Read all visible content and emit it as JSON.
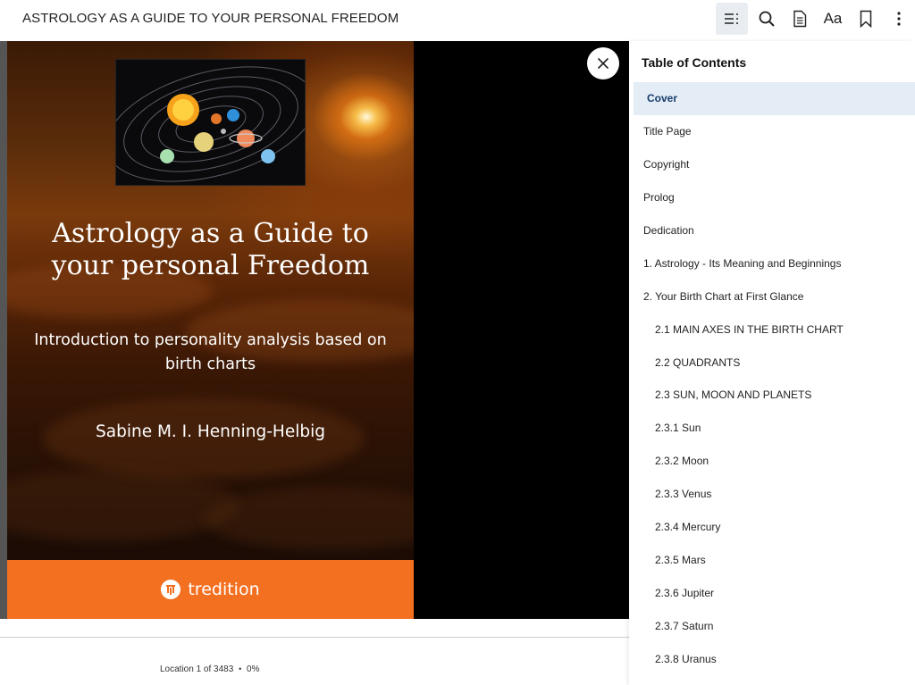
{
  "book": {
    "title": "ASTROLOGY AS A GUIDE TO YOUR PERSONAL FREEDOM"
  },
  "toolbar": {
    "buttons": [
      {
        "name": "toc-button",
        "icon": "table-of-contents-icon",
        "active": true
      },
      {
        "name": "search-button",
        "icon": "search-icon"
      },
      {
        "name": "notes-button",
        "icon": "document-icon"
      },
      {
        "name": "font-settings-button",
        "icon": "font-icon",
        "label": "Aa"
      },
      {
        "name": "bookmark-button",
        "icon": "bookmark-icon"
      },
      {
        "name": "more-options-button",
        "icon": "vertical-dots-icon"
      }
    ]
  },
  "cover": {
    "title_line1": "Astrology as a Guide to",
    "title_line2": "your personal Freedom",
    "subtitle_line1": "Introduction to personality analysis based on",
    "subtitle_line2": "birth charts",
    "author": "Sabine M. I. Henning-Helbig",
    "publisher": "tredition",
    "band_color": "#f37021"
  },
  "footer": {
    "location": "Location 1 of 3483",
    "separator": "•",
    "percent": "0%"
  },
  "toc": {
    "heading": "Table of Contents",
    "active_index": 0,
    "items": [
      {
        "label": "Cover",
        "level": 0
      },
      {
        "label": "Title Page",
        "level": 0
      },
      {
        "label": "Copyright",
        "level": 0
      },
      {
        "label": "Prolog",
        "level": 0
      },
      {
        "label": "Dedication",
        "level": 0
      },
      {
        "label": "1. Astrology - Its Meaning and Beginnings",
        "level": 0
      },
      {
        "label": "2. Your Birth Chart at First Glance",
        "level": 0
      },
      {
        "label": "2.1 MAIN AXES IN THE BIRTH CHART",
        "level": 1
      },
      {
        "label": "2.2 QUADRANTS",
        "level": 1
      },
      {
        "label": "2.3 SUN, MOON AND PLANETS",
        "level": 1
      },
      {
        "label": "2.3.1 Sun",
        "level": 1
      },
      {
        "label": "2.3.2 Moon",
        "level": 1
      },
      {
        "label": "2.3.3 Venus",
        "level": 1
      },
      {
        "label": "2.3.4 Mercury",
        "level": 1
      },
      {
        "label": "2.3.5 Mars",
        "level": 1
      },
      {
        "label": "2.3.6 Jupiter",
        "level": 1
      },
      {
        "label": "2.3.7 Saturn",
        "level": 1
      },
      {
        "label": "2.3.8 Uranus",
        "level": 1
      }
    ]
  },
  "colors": {
    "active_toc_bg": "#e4ecf5",
    "active_toc_text": "#163d6b",
    "active_toolbar_bg": "#e9edf2"
  }
}
